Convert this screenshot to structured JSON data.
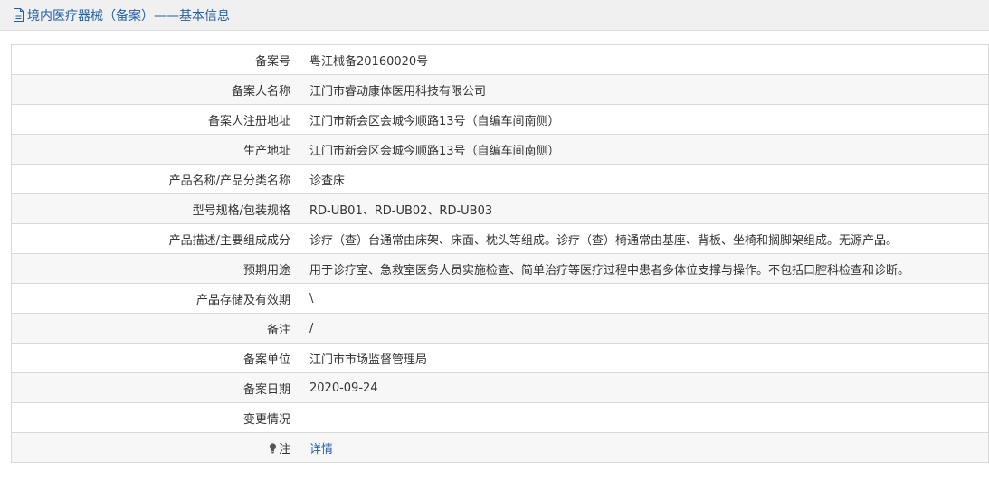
{
  "header": {
    "title": "境内医疗器械（备案）——基本信息",
    "icon": "document-icon",
    "color": "#2160a8"
  },
  "rows": [
    {
      "label": "备案号",
      "value": "粤江械备20160020号"
    },
    {
      "label": "备案人名称",
      "value": "江门市睿动康体医用科技有限公司"
    },
    {
      "label": "备案人注册地址",
      "value": "江门市新会区会城今顺路13号（自编车间南侧）"
    },
    {
      "label": "生产地址",
      "value": "江门市新会区会城今顺路13号（自编车间南侧）"
    },
    {
      "label": "产品名称/产品分类名称",
      "value": "诊查床"
    },
    {
      "label": "型号规格/包装规格",
      "value": "RD-UB01、RD-UB02、RD-UB03"
    },
    {
      "label": "产品描述/主要组成成分",
      "value": "诊疗（查）台通常由床架、床面、枕头等组成。诊疗（查）椅通常由基座、背板、坐椅和搁脚架组成。无源产品。"
    },
    {
      "label": "预期用途",
      "value": "用于诊疗室、急救室医务人员实施检查、简单治疗等医疗过程中患者多体位支撑与操作。不包括口腔科检查和诊断。"
    },
    {
      "label": "产品存储及有效期",
      "value": "\\"
    },
    {
      "label": "备注",
      "value": "/"
    },
    {
      "label": "备案单位",
      "value": "江门市市场监督管理局"
    },
    {
      "label": "备案日期",
      "value": "2020-09-24"
    },
    {
      "label": "变更情况",
      "value": ""
    }
  ],
  "note": {
    "label": "注",
    "icon": "lightbulb-icon",
    "link": "详情"
  }
}
